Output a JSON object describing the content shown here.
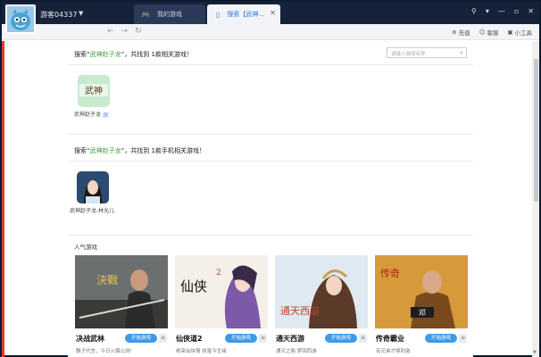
{
  "header": {
    "username": "游客04337",
    "tabs": [
      {
        "label": "我的游戏"
      },
      {
        "label": "搜索【武神..."
      }
    ]
  },
  "toolbar": {
    "tools": [
      {
        "label": "充值",
        "icon": "charge-icon"
      },
      {
        "label": "客服",
        "icon": "service-icon"
      },
      {
        "label": "小工具",
        "icon": "toolbox-icon"
      }
    ]
  },
  "search": {
    "placeholder": "请输入游戏名称",
    "result_prefix": "搜索“",
    "keyword": "武神赵子龙",
    "result_suffix_pc": "”，共找到 1款相关游戏！",
    "result_suffix_mobile": "”，共找到 1款手机相关游戏！"
  },
  "pc_results": [
    {
      "name": "武神赵子龙",
      "badge": "页"
    }
  ],
  "mobile_results": [
    {
      "name": "武神赵子龙-林允儿"
    }
  ],
  "popular": {
    "title": "人气游戏",
    "games": [
      {
        "name": "决战武林",
        "play_label": "开始游戏",
        "desc": "飘子代言，今日火爆公测！"
      },
      {
        "name": "仙侠道2",
        "play_label": "开始游戏",
        "desc": "绝染仙侠情 执笔今生缘"
      },
      {
        "name": "通天西游",
        "play_label": "开始游戏",
        "desc": "通天之路 梦回西游"
      },
      {
        "name": "传奇霸业",
        "play_label": "开始游戏",
        "desc": "有兄弟才够刺激"
      }
    ]
  },
  "colors": {
    "titlebar": "#16223a",
    "accent": "#3e9ae8",
    "highlight": "#3f9a3f"
  }
}
